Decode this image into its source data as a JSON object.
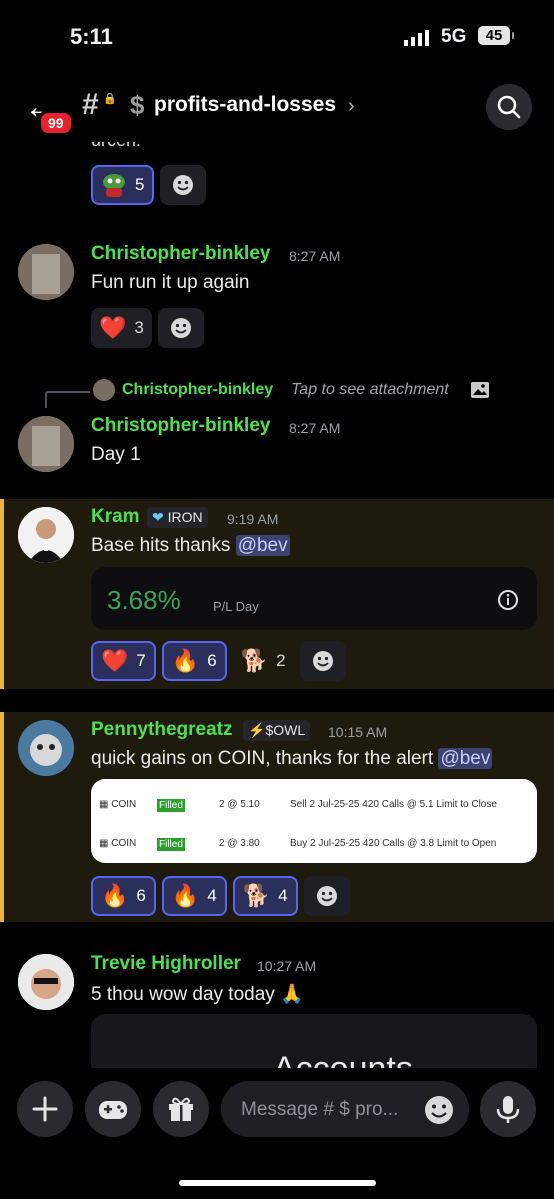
{
  "status_bar": {
    "time": "5:11",
    "network": "5G",
    "battery": "45"
  },
  "header": {
    "back_badge": "99",
    "channel_name": "profits-and-losses"
  },
  "feed": {
    "cutoff_text": "urcen!",
    "top_reactions": [
      {
        "emoji": "pepe",
        "count": "5"
      }
    ],
    "messages": [
      {
        "username": "Christopher-binkley",
        "time": "8:27 AM",
        "text": "Fun run it up again",
        "reactions": [
          {
            "emoji": "❤️",
            "count": "3"
          }
        ]
      },
      {
        "reply": {
          "username": "Christopher-binkley",
          "text": "Tap to see attachment"
        },
        "username": "Christopher-binkley",
        "time": "8:27 AM",
        "text": "Day 1"
      },
      {
        "username": "Kram",
        "tag": "IRON",
        "time": "9:19 AM",
        "text": "Base hits thanks ",
        "mention": "@bev",
        "pl_card": {
          "value": "3.68%",
          "label": "P/L Day"
        },
        "reactions": [
          {
            "emoji": "❤️",
            "count": "7"
          },
          {
            "emoji": "🔥",
            "count": "6"
          },
          {
            "emoji": "🐕",
            "count": "2"
          }
        ]
      },
      {
        "username": "Pennythegreatz",
        "tag": "$OWL",
        "time": "10:15 AM",
        "text": "quick gains on COIN, thanks for the alert ",
        "mention": "@bev",
        "orders": [
          {
            "symbol": "COIN",
            "status": "Filled",
            "qty": "2 @ 5.10",
            "desc": "Sell 2 Jul-25-25 420 Calls @ 5.1 Limit to Close"
          },
          {
            "symbol": "COIN",
            "status": "Filled",
            "qty": "2 @ 3.80",
            "desc": "Buy 2 Jul-25-25 420 Calls @ 3.8 Limit to Open"
          }
        ],
        "reactions": [
          {
            "emoji": "🔥",
            "count": "6"
          },
          {
            "emoji": "🔥",
            "count": "4"
          },
          {
            "emoji": "🐕",
            "count": "4"
          }
        ]
      },
      {
        "username": "Trevie Highroller",
        "time": "10:27 AM",
        "text": "5 thou wow day today 🙏",
        "card_text": "Accounts"
      }
    ]
  },
  "composer": {
    "placeholder": "Message # $ pro..."
  },
  "colors": {
    "username": "#4ee04f",
    "highlight_bar": "#f0b232",
    "gain": "#3ba55c",
    "accent": "#5865f2"
  }
}
